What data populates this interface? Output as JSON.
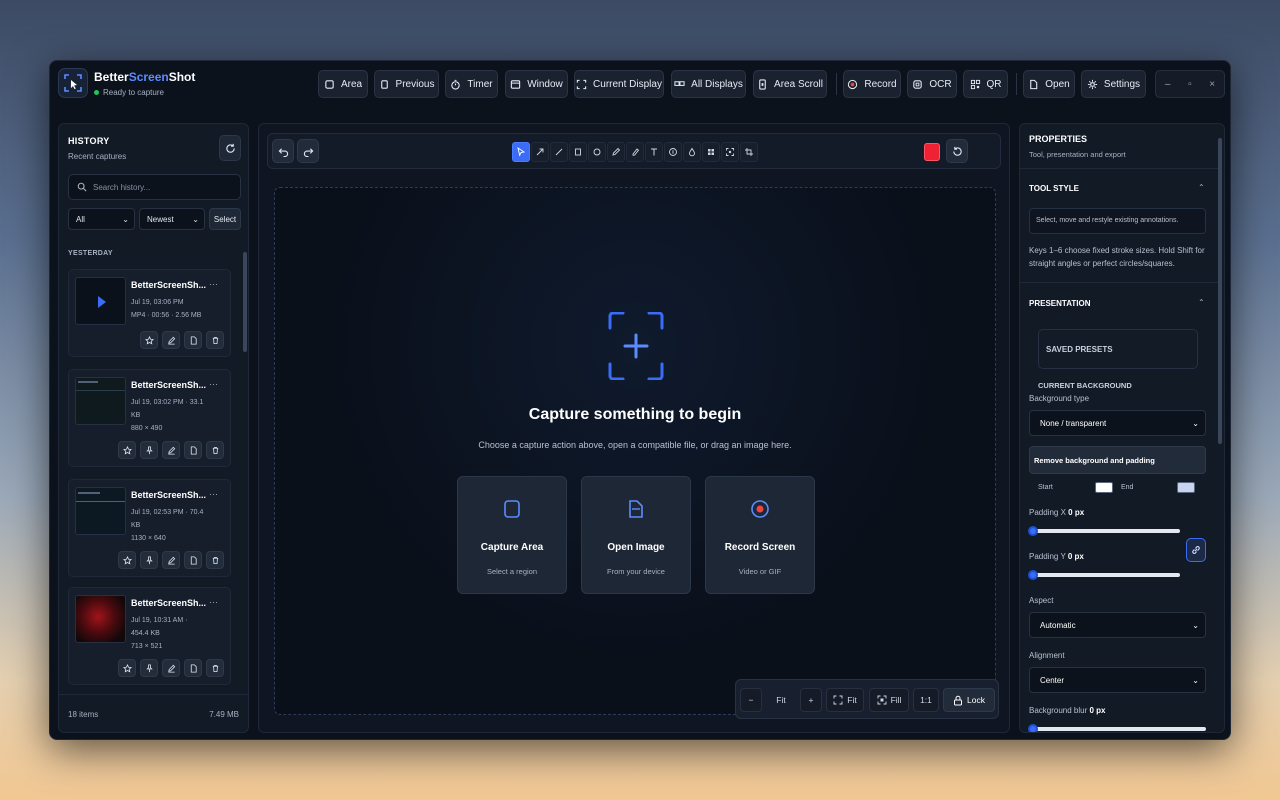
{
  "app": {
    "name_part1": "Better",
    "name_part2": "Screen",
    "name_part3": "Shot",
    "status": "Ready to capture",
    "accent_color": "#5b8cff",
    "status_color": "#22c55e"
  },
  "capture_toolbar": [
    {
      "label": "Area",
      "icon": "square-icon"
    },
    {
      "label": "Previous",
      "icon": "copy-icon"
    },
    {
      "label": "Timer",
      "icon": "stopwatch-icon"
    },
    {
      "label": "Window",
      "icon": "window-icon"
    },
    {
      "label": "Current Display",
      "icon": "frame-corners-icon"
    },
    {
      "label": "All Displays",
      "icon": "displays-icon"
    },
    {
      "label": "Area Scroll",
      "icon": "phone-scroll-icon"
    },
    {
      "label": "Record",
      "icon": "record-icon"
    },
    {
      "label": "OCR",
      "icon": "ocr-icon"
    },
    {
      "label": "QR",
      "icon": "qr-icon"
    },
    {
      "label": "Open",
      "icon": "file-icon"
    },
    {
      "label": "Settings",
      "icon": "gear-icon"
    }
  ],
  "window_controls": {
    "minimize": "–",
    "maximize": "▫",
    "close": "×"
  },
  "history": {
    "title": "HISTORY",
    "subtitle": "Recent captures",
    "search_placeholder": "Search history...",
    "filter_value": "All",
    "sort_value": "Newest",
    "select_label": "Select",
    "group_label": "YESTERDAY",
    "items": [
      {
        "name": "BetterScreenSh...",
        "meta1": "Jul 19, 03:06 PM",
        "meta2": "MP4 · 00:56 · 2.56 MB",
        "meta3": ""
      },
      {
        "name": "BetterScreenSh...",
        "meta1": "Jul 19, 03:02 PM · 33.1",
        "meta2": "KB",
        "meta3": "880 × 490"
      },
      {
        "name": "BetterScreenSh...",
        "meta1": "Jul 19, 02:53 PM · 70.4",
        "meta2": "KB",
        "meta3": "1130 × 640"
      },
      {
        "name": "BetterScreenSh...",
        "meta1": "Jul 19, 10:31 AM ·",
        "meta2": "454.4 KB",
        "meta3": "713 × 521"
      }
    ],
    "more_glyph": "···",
    "footer_count": "18 items",
    "footer_size": "7.49 MB"
  },
  "editor": {
    "empty_title": "Capture something to begin",
    "empty_subtitle": "Choose a capture action above, open a compatible file, or drag an image here.",
    "stroke_color": "#ee2233",
    "actions": [
      {
        "title": "Capture Area",
        "subtitle": "Select a region",
        "icon": "area-icon"
      },
      {
        "title": "Open Image",
        "subtitle": "From your device",
        "icon": "file-icon"
      },
      {
        "title": "Record Screen",
        "subtitle": "Video or GIF",
        "icon": "record-icon"
      }
    ],
    "zoom": {
      "minus": "−",
      "fit_label": "Fit",
      "plus": "+",
      "fit2_label": "Fit",
      "fill_label": "Fill",
      "one_to_one": "1:1",
      "lock_label": "Lock"
    }
  },
  "properties": {
    "title": "PROPERTIES",
    "subtitle": "Tool, presentation and export",
    "tool_style": {
      "title": "TOOL STYLE",
      "info": "Select, move and restyle existing annotations.",
      "hint": "Keys 1–6 choose fixed stroke sizes. Hold Shift for straight angles or perfect circles/squares."
    },
    "presentation": {
      "title": "PRESENTATION",
      "saved_presets": "SAVED PRESETS",
      "current_background": "CURRENT BACKGROUND",
      "background_type_label": "Background type",
      "background_type_value": "None / transparent",
      "remove_label": "Remove background and padding",
      "start_label": "Start",
      "end_label": "End",
      "start_color": "#ffffff",
      "end_color": "#c9d4ee",
      "padding_x_label": "Padding X",
      "padding_x_value": "0 px",
      "padding_x_level": 0,
      "padding_y_label": "Padding Y",
      "padding_y_value": "0 px",
      "padding_y_level": 0,
      "aspect_label": "Aspect",
      "aspect_value": "Automatic",
      "alignment_label": "Alignment",
      "alignment_value": "Center",
      "blur_label": "Background blur",
      "blur_value": "0 px",
      "blur_level": 0
    }
  }
}
